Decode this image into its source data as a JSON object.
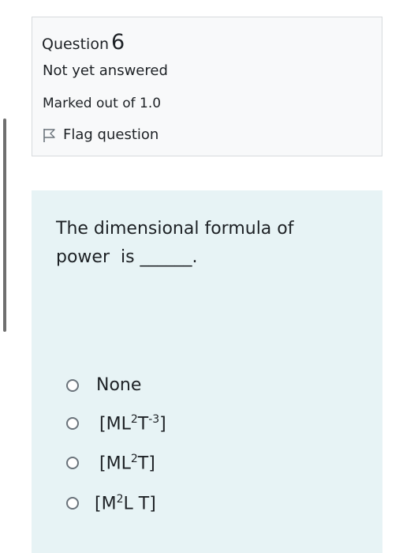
{
  "question": {
    "label": "Question",
    "number": "6",
    "state": "Not yet answered",
    "grade": "Marked out of 1.0",
    "flag_label": "Flag question",
    "text_line1": "The dimensional formula of",
    "text_line2": "power  is ______.",
    "flag_icon": "flag-outline-icon"
  },
  "answers": [
    {
      "base": "None",
      "sup1": "",
      "mid": "",
      "sup2": "",
      "end": ""
    },
    {
      "base": "[ML",
      "sup1": "2",
      "mid": "T",
      "sup2": "-3",
      "end": "]"
    },
    {
      "base": "[ML",
      "sup1": "2",
      "mid": "T]",
      "sup2": "",
      "end": ""
    },
    {
      "base": "[M",
      "sup1": "2",
      "mid": "L T]",
      "sup2": "",
      "end": ""
    }
  ],
  "colors": {
    "info_bg": "#f8f9fa",
    "content_bg": "#e7f3f5",
    "text": "#1d2125"
  }
}
